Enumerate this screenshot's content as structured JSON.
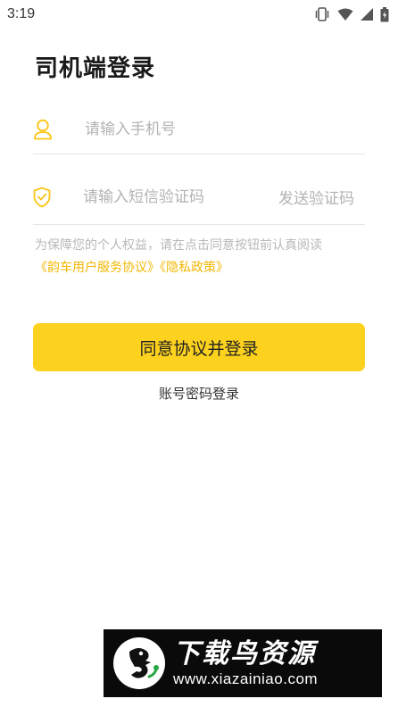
{
  "status_bar": {
    "time": "3:19",
    "icons": [
      "vibrate-icon",
      "wifi-icon",
      "signal-icon",
      "battery-icon"
    ]
  },
  "page": {
    "title": "司机端登录"
  },
  "phone_input": {
    "icon": "user-icon",
    "placeholder": "请输入手机号",
    "value": ""
  },
  "code_input": {
    "icon": "shield-check-icon",
    "placeholder": "请输入短信验证码",
    "value": "",
    "send_label": "发送验证码"
  },
  "agreement": {
    "text": "为保障您的个人权益，请在点击同意按钮前认真阅读",
    "links": [
      "《韵车用户服务协议》",
      "《隐私政策》"
    ]
  },
  "login_button": {
    "label": "同意协议并登录"
  },
  "password_login": {
    "label": "账号密码登录"
  },
  "watermark": {
    "title": "下载鸟资源",
    "url": "www.xiazainiao.com"
  },
  "colors": {
    "accent": "#fdd21f",
    "link": "#f2b705",
    "placeholder": "#b3b3b3",
    "divider": "#e6e6e6"
  }
}
